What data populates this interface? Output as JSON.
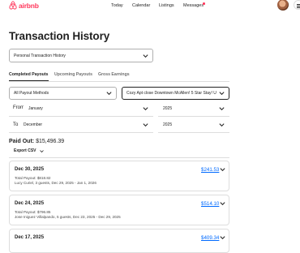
{
  "brand": {
    "name": "airbnb",
    "color": "#ff385c"
  },
  "nav": {
    "links": [
      "Today",
      "Calendar",
      "Listings",
      "Messages"
    ],
    "has_unread_messages": true
  },
  "page": {
    "title": "Transaction History"
  },
  "history_type": {
    "selected": "Personal Transaction History"
  },
  "tabs": [
    {
      "label": "Completed Payouts",
      "active": true
    },
    {
      "label": "Upcoming Payouts",
      "active": false
    },
    {
      "label": "Gross Earnings",
      "active": false
    }
  ],
  "filters": {
    "payout_method": "All Payout Methods",
    "listing": "Cozy Apt close Downtown McAllen! 5 Star Stay! U",
    "from_label": "From:",
    "from_month": "January",
    "from_year": "2025",
    "to_label": "To:",
    "to_month": "December",
    "to_year": "2025"
  },
  "summary": {
    "paid_out_label": "Paid Out:",
    "paid_out_value": "$15,496.39",
    "export_label": "Export CSV"
  },
  "transactions": [
    {
      "date": "Dec 30, 2025",
      "amount": "$241.53",
      "total_payout": "Total Payout: $818.82",
      "details": "Lucy Curiel, 3 guests, Dec 29, 2025 - Jan 1, 2026"
    },
    {
      "date": "Dec 24, 2025",
      "amount": "$514.10",
      "total_payout": "Total Payout: $796.85",
      "details": "Jose Iniguez Villalpando, 5 guests, Dec 23, 2025 - Dec 29, 2025"
    },
    {
      "date": "Dec 17, 2025",
      "amount": "$409.34",
      "total_payout": "",
      "details": ""
    }
  ]
}
